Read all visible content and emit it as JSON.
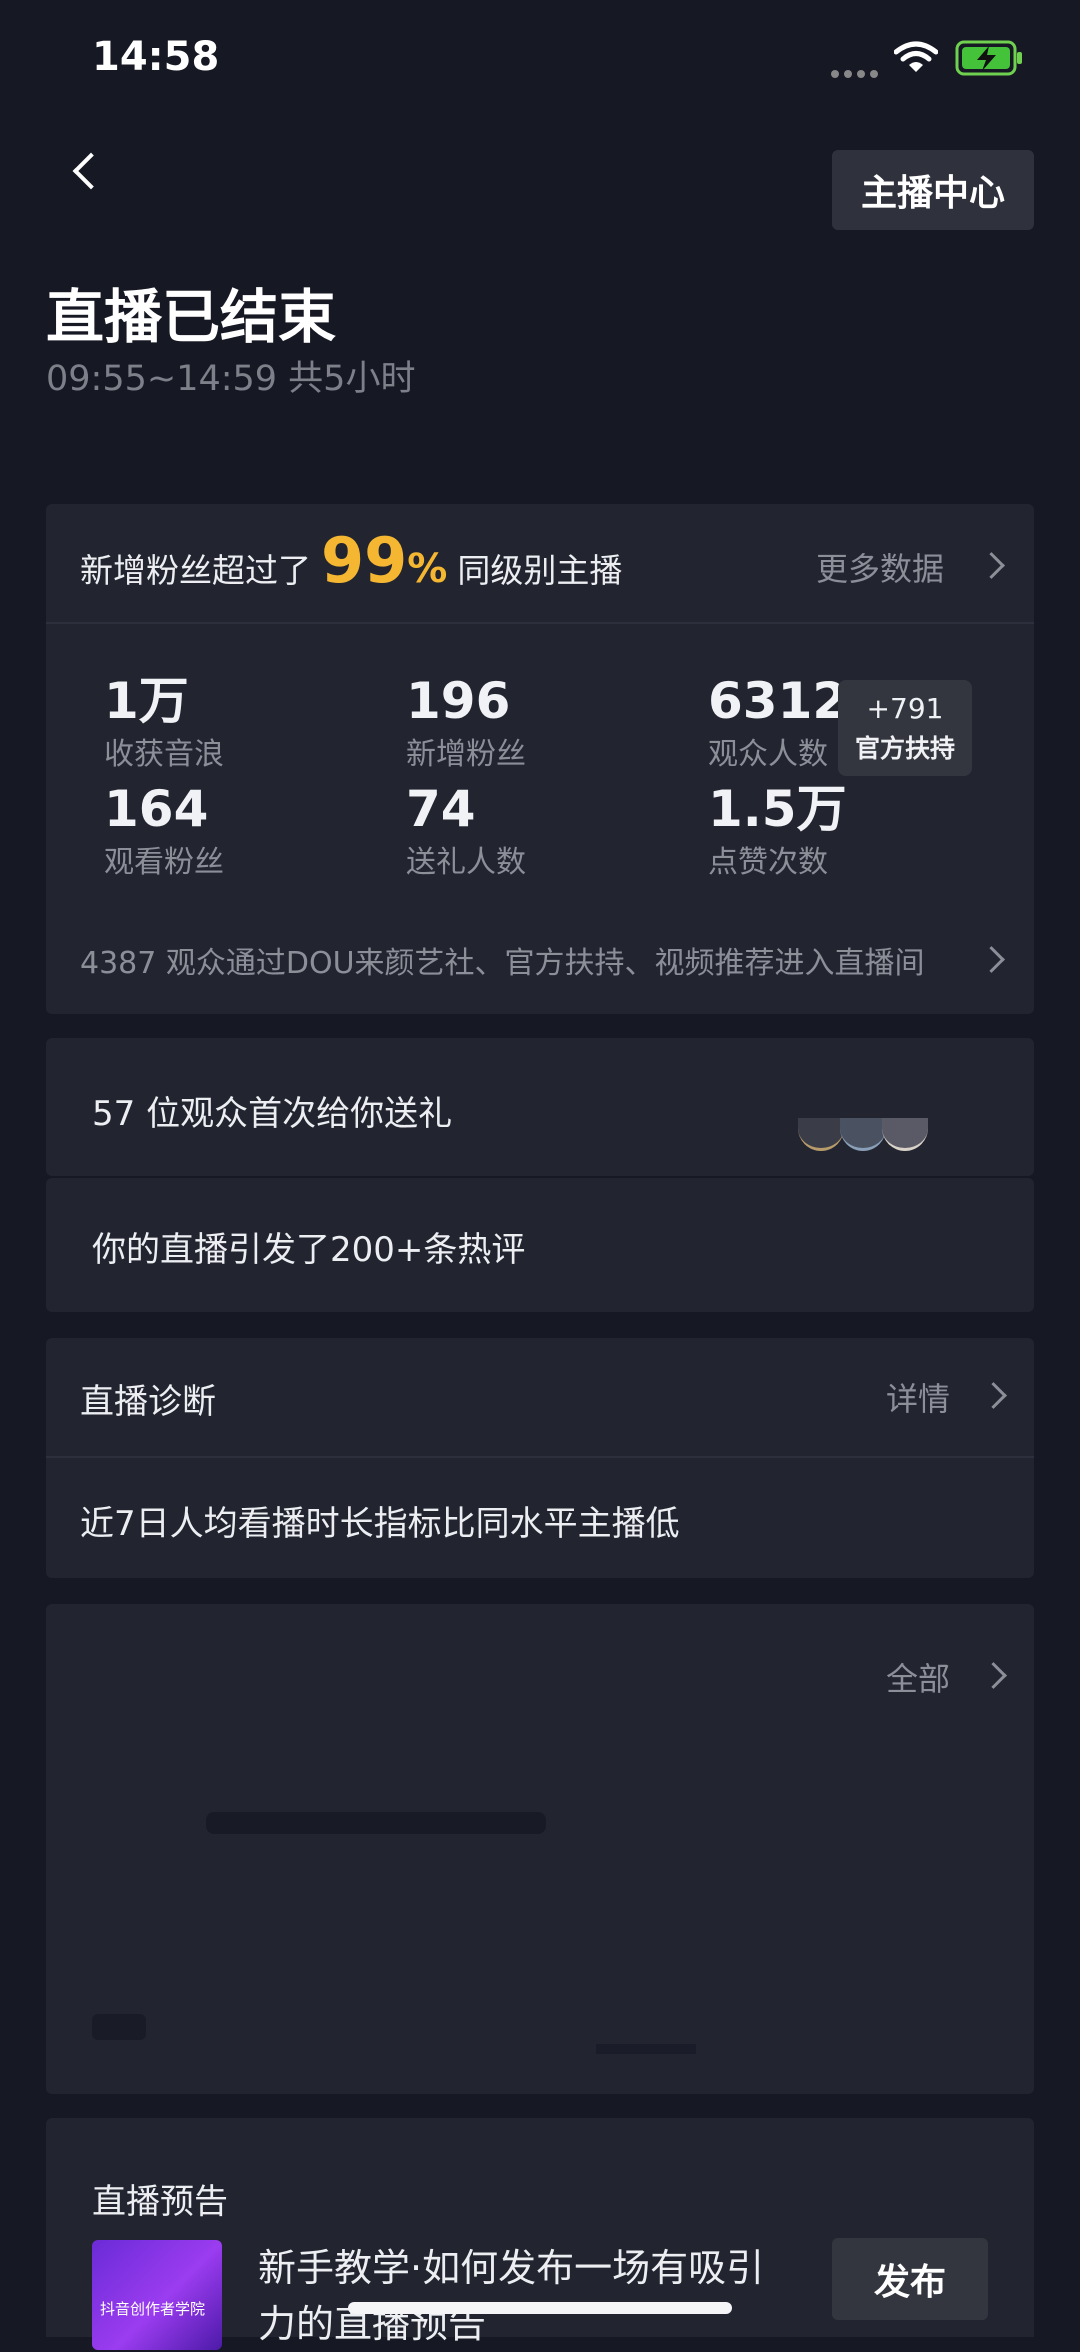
{
  "status_bar": {
    "time": "14:58"
  },
  "header": {
    "anchor_center_label": "主播中心",
    "title": "直播已结束",
    "time_range": "09:55~14:59 共5小时"
  },
  "summary": {
    "text_before": "新增粉丝超过了",
    "percent_value": "99",
    "percent_sign": "%",
    "text_after": "同级别主播",
    "more_label": "更多数据",
    "stats": [
      {
        "value": "1万",
        "label": "收获音浪"
      },
      {
        "value": "196",
        "label": "新增粉丝"
      },
      {
        "value": "6312",
        "label": "观众人数"
      },
      {
        "value": "164",
        "label": "观看粉丝"
      },
      {
        "value": "74",
        "label": "送礼人数"
      },
      {
        "value": "1.5万",
        "label": "点赞次数"
      }
    ],
    "boost_badge": {
      "value": "+791",
      "label": "官方扶持"
    },
    "source_text": "4387 观众通过DOU来颜艺社、官方扶持、视频推荐进入直播间"
  },
  "gifts": {
    "text": "57 位观众首次给你送礼"
  },
  "comments": {
    "text": "你的直播引发了200+条热评"
  },
  "diagnosis": {
    "title": "直播诊断",
    "detail_label": "详情",
    "text": "近7日人均看播时长指标比同水平主播低"
  },
  "hidden_section": {
    "all_label": "全部"
  },
  "preview": {
    "title": "直播预告",
    "thumbnail_caption": "抖音创作者学院",
    "description": "新手教学·如何发布一场有吸引力的直播预告",
    "publish_label": "发布"
  },
  "colors": {
    "background": "#161824",
    "card": "#222430",
    "accent": "#f5b731"
  }
}
